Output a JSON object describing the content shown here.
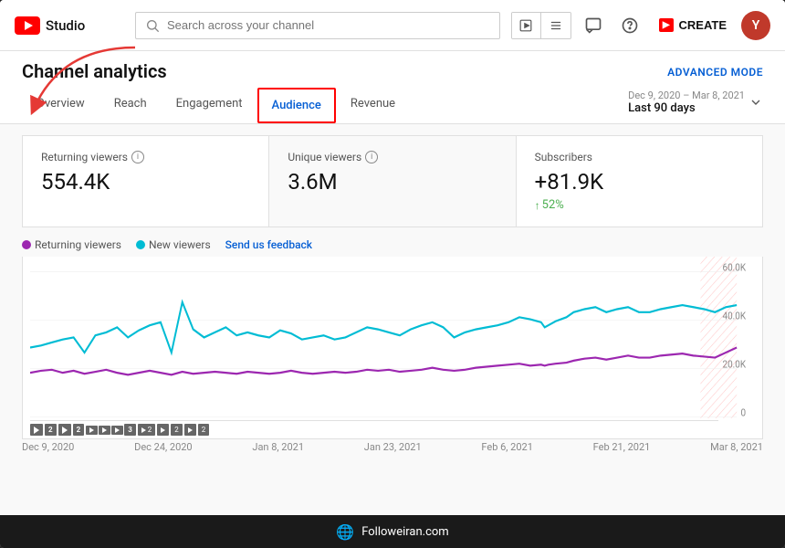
{
  "header": {
    "logo_text": "Studio",
    "search_placeholder": "Search across your channel",
    "create_label": "CREATE",
    "avatar_letter": "Y"
  },
  "page": {
    "title": "Channel analytics",
    "advanced_mode_label": "ADVANCED MODE"
  },
  "date_range": {
    "line1": "Dec 9, 2020 – Mar 8, 2021",
    "line2": "Last 90 days"
  },
  "tabs": [
    {
      "id": "overview",
      "label": "Overview",
      "active": false
    },
    {
      "id": "reach",
      "label": "Reach",
      "active": false
    },
    {
      "id": "engagement",
      "label": "Engagement",
      "active": false
    },
    {
      "id": "audience",
      "label": "Audience",
      "active": true,
      "highlighted": true
    },
    {
      "id": "revenue",
      "label": "Revenue",
      "active": false
    }
  ],
  "stats": [
    {
      "id": "returning-viewers",
      "label": "Returning viewers",
      "value": "554.4K",
      "change": null,
      "highlighted": false
    },
    {
      "id": "unique-viewers",
      "label": "Unique viewers",
      "value": "3.6M",
      "change": null,
      "highlighted": true
    },
    {
      "id": "subscribers",
      "label": "Subscribers",
      "value": "+81.9K",
      "change": "52%",
      "highlighted": false
    }
  ],
  "legend": [
    {
      "id": "returning",
      "label": "Returning viewers",
      "color": "#9c27b0"
    },
    {
      "id": "new",
      "label": "New viewers",
      "color": "#00bcd4"
    }
  ],
  "feedback_label": "Send us feedback",
  "chart": {
    "y_labels": [
      "60.0K",
      "40.0K",
      "20.0K",
      "0"
    ],
    "x_labels": [
      "Dec 9, 2020",
      "Dec 24, 2020",
      "Jan 8, 2021",
      "Jan 23, 2021",
      "Feb 6, 2021",
      "Feb 21, 2021",
      "Mar 8, 2021"
    ]
  },
  "bottom_bar": {
    "site_label": "Followeiran.com"
  }
}
